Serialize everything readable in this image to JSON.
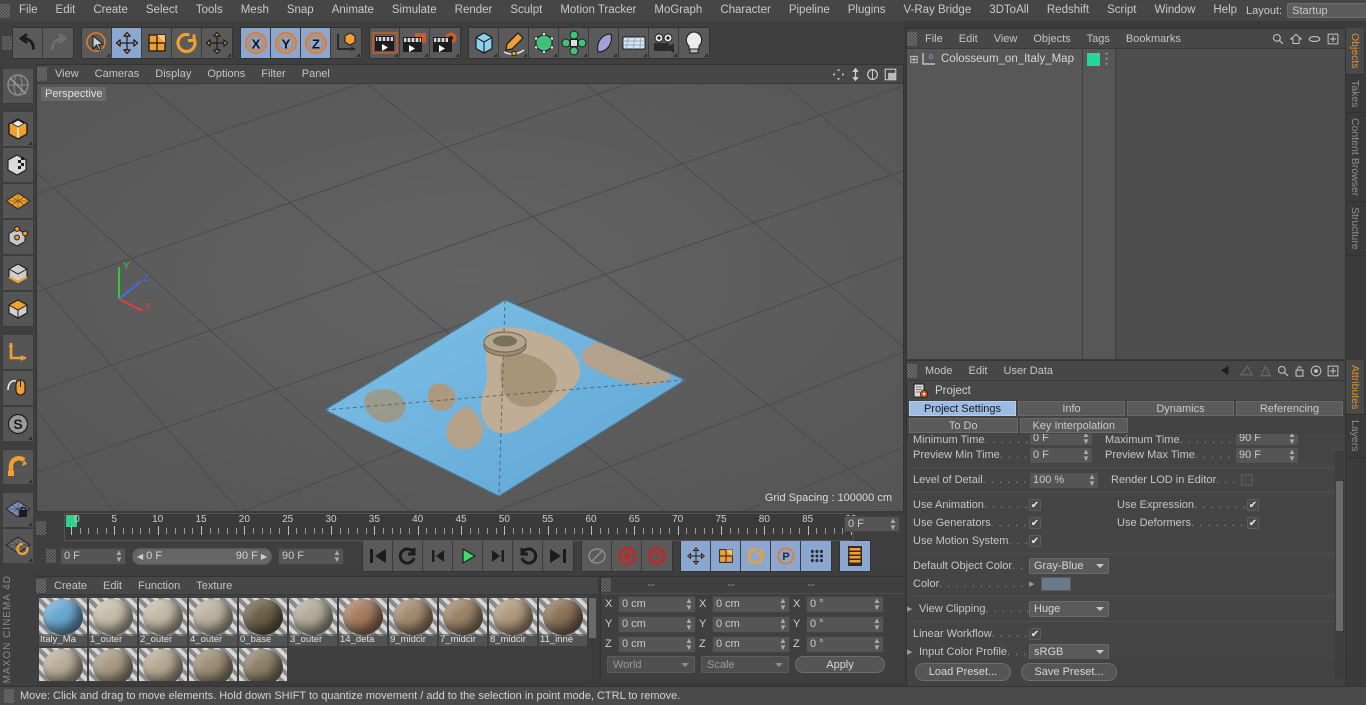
{
  "app": {
    "brand": "MAXON CINEMA 4D",
    "status": "Move: Click and drag to move elements. Hold down SHIFT to quantize movement / add to the selection in point mode, CTRL to remove."
  },
  "top_menu": {
    "items": [
      "File",
      "Edit",
      "Create",
      "Select",
      "Tools",
      "Mesh",
      "Snap",
      "Animate",
      "Simulate",
      "Render",
      "Sculpt",
      "Motion Tracker",
      "MoGraph",
      "Character",
      "Pipeline",
      "Plugins",
      "V-Ray Bridge",
      "3DToAll",
      "Redshift",
      "Script",
      "Window",
      "Help"
    ],
    "layout_label": "Layout:",
    "layout_value": "Startup"
  },
  "main_toolbar": {
    "groups": [
      {
        "name": "undo",
        "icons": [
          "undo-icon",
          "redo-icon"
        ]
      },
      {
        "name": "transform",
        "icons": [
          "select-icon",
          "move-icon",
          "scale-icon",
          "rotate-icon",
          "move-tool-icon"
        ]
      },
      {
        "name": "axis-lock",
        "icons": [
          "x-axis-icon",
          "y-axis-icon",
          "z-axis-icon",
          "world-coord-icon"
        ]
      },
      {
        "name": "render",
        "icons": [
          "render-view-icon",
          "render-region-icon",
          "render-settings-icon"
        ]
      },
      {
        "name": "create",
        "icons": [
          "cube-icon",
          "spline-pen-icon",
          "nurbs-icon",
          "array-icon",
          "bend-icon",
          "floor-icon",
          "camera-icon",
          "light-icon"
        ]
      }
    ]
  },
  "left_toolbar": {
    "icons": [
      "live-selection-icon",
      "model-mode-icon",
      "texture-mode-icon",
      "polygon-grid-icon",
      "point-mode-icon",
      "edge-mode-icon",
      "polygon-mode-icon",
      "axis-mode-icon",
      "viewport-solo-icon",
      "enable-snap-s-icon",
      "magnet-icon",
      "workplane-lock-icon",
      "workplane-rotate-icon"
    ]
  },
  "viewport": {
    "menu": [
      "View",
      "Cameras",
      "Display",
      "Options",
      "Filter",
      "Panel"
    ],
    "right_icons": [
      "pan-icon",
      "dolly-icon",
      "rotate-view-icon",
      "maximize-icon"
    ],
    "label": "Perspective",
    "grid_spacing": "Grid Spacing : 100000 cm",
    "axes": {
      "x": "X",
      "y": "Y",
      "z": "Z"
    }
  },
  "timeline": {
    "ticks": [
      0,
      5,
      10,
      15,
      20,
      25,
      30,
      35,
      40,
      45,
      50,
      55,
      60,
      65,
      70,
      75,
      80,
      85,
      90
    ],
    "current_frame": "0 F",
    "start_field": "0 F",
    "range_start": "0 F",
    "range_end": "90 F",
    "end_field": "90 F",
    "buttons": [
      "go-to-start-icon",
      "play-backwards-icon",
      "prev-frame-icon",
      "play-icon",
      "next-frame-icon",
      "loop-icon",
      "go-to-end-icon",
      "autokey-icon",
      "record-icon",
      "key-selection-icon"
    ],
    "right_toggles": [
      "position-key-icon",
      "scale-key-icon",
      "rotation-key-icon",
      "param-key-icon",
      "pla-key-icon"
    ],
    "timeline_toggle": "timeline-icon"
  },
  "material_manager": {
    "menu": [
      "Create",
      "Edit",
      "Function",
      "Texture"
    ],
    "materials": [
      {
        "name": "Italy_Ma",
        "color": "#6aa8d0"
      },
      {
        "name": "1_outer",
        "color": "#c6bdaa"
      },
      {
        "name": "2_outer",
        "color": "#c2b9a6"
      },
      {
        "name": "4_outer",
        "color": "#bdb2a0"
      },
      {
        "name": "0_base",
        "color": "#6c6149"
      },
      {
        "name": "3_outer",
        "color": "#b3aa98"
      },
      {
        "name": "14_deta",
        "color": "#a47b5e"
      },
      {
        "name": "9_midcir",
        "color": "#a38a6e"
      },
      {
        "name": "7_midcir",
        "color": "#9c8366"
      },
      {
        "name": "8_midcir",
        "color": "#b09a7e"
      },
      {
        "name": "11_inne",
        "color": "#8a7256"
      },
      {
        "name": "",
        "color": "#b8ad99"
      },
      {
        "name": "",
        "color": "#a89a84"
      },
      {
        "name": "",
        "color": "#b5a991"
      },
      {
        "name": "",
        "color": "#9d8e76"
      },
      {
        "name": "",
        "color": "#8e8068"
      }
    ]
  },
  "coordinates": {
    "headers": [
      "--",
      "--",
      "--"
    ],
    "rows": [
      {
        "axis": "X",
        "position": "0 cm",
        "size": "0 cm",
        "rotation": "0 °"
      },
      {
        "axis": "Y",
        "position": "0 cm",
        "size": "0 cm",
        "rotation": "0 °"
      },
      {
        "axis": "Z",
        "position": "0 cm",
        "size": "0 cm",
        "rotation": "0 °"
      }
    ],
    "world": "World",
    "scale": "Scale",
    "apply": "Apply"
  },
  "objects": {
    "menu": [
      "File",
      "Edit",
      "View",
      "Objects",
      "Tags",
      "Bookmarks"
    ],
    "right_icons": [
      "search-icon",
      "home-icon",
      "ellipse-icon",
      "expand-icon"
    ],
    "item": {
      "name": "Colosseum_on_Italy_Map",
      "layer": "0",
      "tag_color": "#25d79a"
    }
  },
  "attributes": {
    "menu": [
      "Mode",
      "Edit",
      "User Data"
    ],
    "right_icons": [
      "back-arrow-icon",
      "pin-icon",
      "cone-icon",
      "search-icon",
      "lock-icon",
      "target-icon",
      "expand-icon"
    ],
    "object_title": "Project",
    "tabs_row1": [
      "Project Settings",
      "Info",
      "Dynamics",
      "Referencing"
    ],
    "tabs_row2": [
      "To Do",
      "Key Interpolation"
    ],
    "active_tab": "Project Settings",
    "fields": [
      {
        "type": "pair-num",
        "left_label": "Minimum Time",
        "left_value": "0 F",
        "right_label": "Maximum Time",
        "right_value": "90 F",
        "clipped": true
      },
      {
        "type": "pair-num",
        "left_label": "Preview Min Time",
        "left_value": "0 F",
        "right_label": "Preview Max Time",
        "right_value": "90 F"
      },
      {
        "type": "rule"
      },
      {
        "type": "lod",
        "left_label": "Level of Detail",
        "left_value": "100 %",
        "right_label": "Render LOD in Editor",
        "right_checked": false
      },
      {
        "type": "rule"
      },
      {
        "type": "pair-chk",
        "left_label": "Use Animation",
        "left_checked": true,
        "right_label": "Use Expression",
        "right_checked": true
      },
      {
        "type": "pair-chk",
        "left_label": "Use Generators",
        "left_checked": true,
        "right_label": "Use Deformers",
        "right_checked": true
      },
      {
        "type": "pair-chk",
        "left_label": "Use Motion System",
        "left_checked": true,
        "right_label": "",
        "right_checked": null
      },
      {
        "type": "rule"
      },
      {
        "type": "drop",
        "left_label": "Default Object Color",
        "left_value": "Gray-Blue"
      },
      {
        "type": "color",
        "left_label": "Color",
        "swatch": "#6b788c"
      },
      {
        "type": "rule"
      },
      {
        "type": "drop-arrow",
        "left_label": "View Clipping",
        "left_value": "Huge"
      },
      {
        "type": "rule"
      },
      {
        "type": "chk",
        "left_label": "Linear Workflow",
        "left_checked": true
      },
      {
        "type": "drop-arrow",
        "left_label": "Input Color Profile",
        "left_value": "sRGB"
      },
      {
        "type": "rule"
      }
    ],
    "load_preset": "Load Preset...",
    "save_preset": "Save Preset..."
  },
  "dock_top": {
    "tabs": [
      "Objects",
      "Takes",
      "Content Browser",
      "Structure"
    ],
    "active": "Objects"
  },
  "dock_bottom": {
    "tabs": [
      "Attributes",
      "Layers"
    ],
    "active": "Attributes"
  }
}
